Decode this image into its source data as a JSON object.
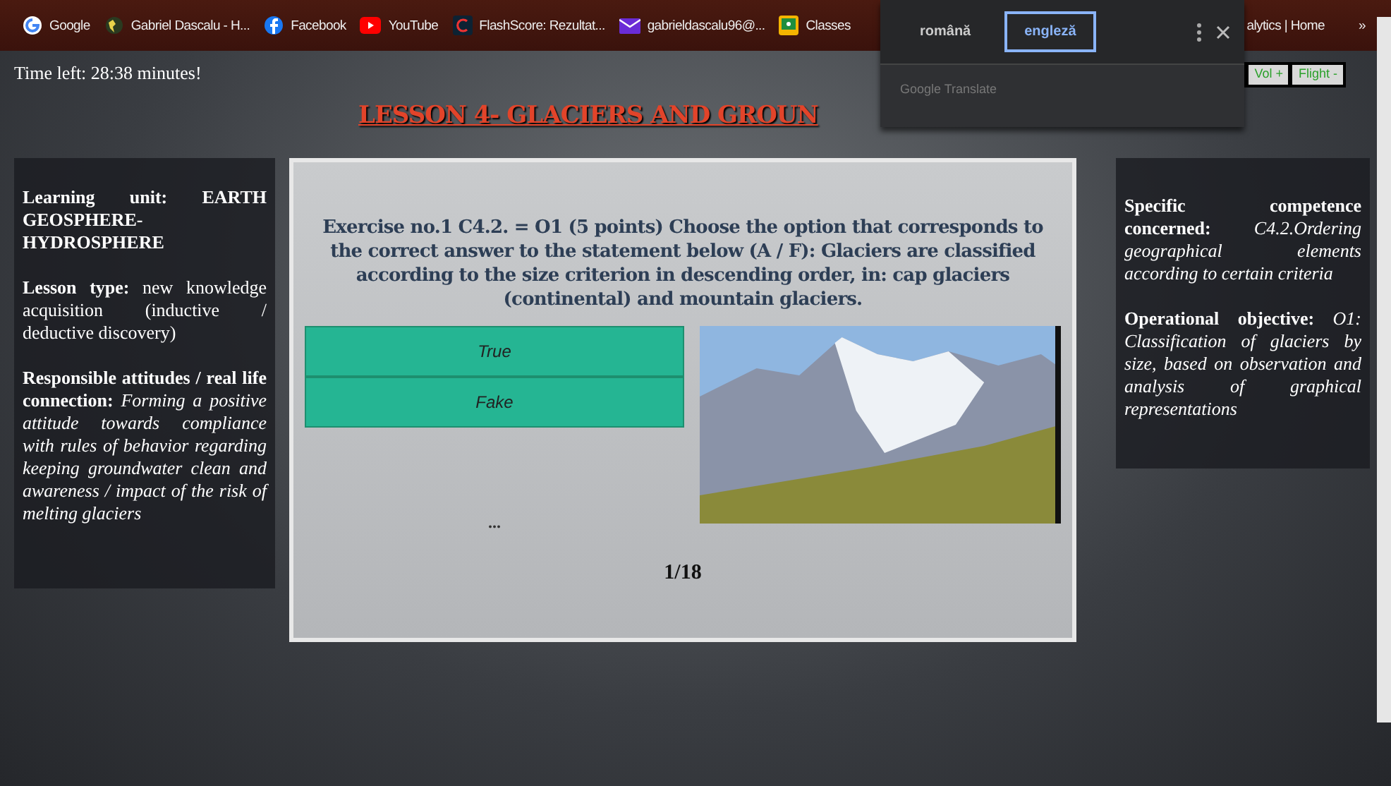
{
  "bookmarks": [
    "Google",
    "Gabriel Dascalu - H...",
    "Facebook",
    "YouTube",
    "FlashScore: Rezultat...",
    "gabrieldascalu96@...",
    "Classes",
    "alytics | Home"
  ],
  "bookmarks_more": "»",
  "translate_popup": {
    "tabs": [
      {
        "label": "română",
        "selected": false
      },
      {
        "label": "engleză",
        "selected": true
      }
    ],
    "footer": "Google Translate"
  },
  "timer": "Time left: 28:38 minutes!",
  "top_buttons": [
    "Vol +",
    "Flight -"
  ],
  "title": "LESSON 4- GLACIERS AND GROUN",
  "left_panel": [
    "**Learning unit: EARTH GEOSPHERE-HYDROSPHERE**",
    "**Lesson type:** new knowledge acquisition (inductive / deductive discovery)",
    "**Responsible attitudes / real life connection:** *Forming a positive attitude towards compliance with rules of behavior regarding keeping groundwater clean and awareness / impact of the risk of melting glaciers*"
  ],
  "exercise": {
    "question": "Exercise no.1 C4.2. = O1 (5 points) Choose the option that corresponds to the correct answer to the statement below (A / F): Glaciers are classified according to the size criterion in descending order, in: cap glaciers (continental) and mountain glaciers.",
    "options": [
      {
        "label": "True",
        "selected": false
      },
      {
        "label": "Fake",
        "selected": false
      }
    ],
    "ellipsis": "...",
    "progress": "1/18"
  },
  "right_panel": [
    "**Specific competence concerned:** *C4.2.Ordering geographical elements according to certain criteria*",
    "**Operational objective:** *O1: Classification of glaciers by size, based on observation and analysis of graphical representations*"
  ]
}
